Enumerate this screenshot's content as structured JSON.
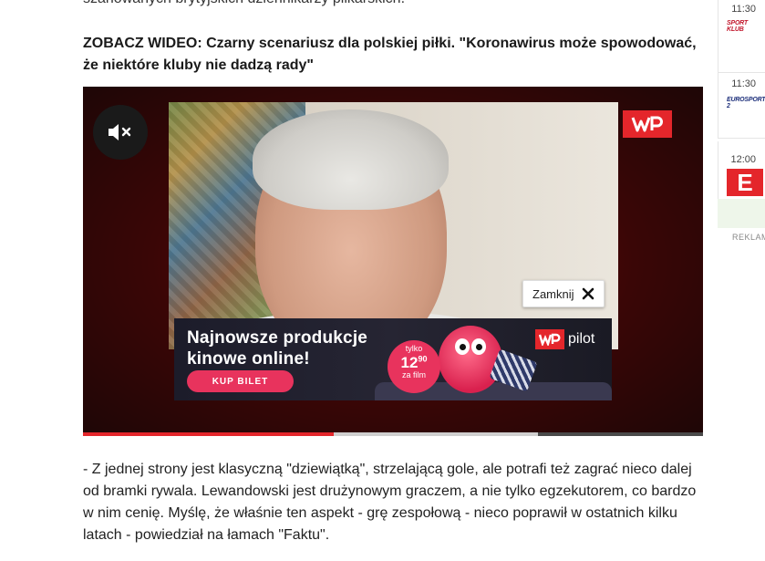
{
  "article": {
    "top_cut_text": "szanowanych brytyjskich dziennikarzy piłkarskich.",
    "headline": "ZOBACZ WIDEO: Czarny scenariusz dla polskiej piłki. \"Koronawirus może spowodować, że niektóre kluby nie dadzą rady\"",
    "paragraph": "- Z jednej strony jest klasyczną \"dziewiątką\", strzelającą gole, ale potrafi też zagrać nieco dalej od bramki rywala. Lewandowski jest drużynowym graczem, a nie tylko egzekutorem, co bardzo w nim cenię. Myślę, że właśnie ten aspekt - grę zespołową - nieco poprawił w ostatnich kilku latach - powiedział na łamach \"Faktu\"."
  },
  "video": {
    "mute_icon": "mute-icon",
    "logo_text": "WP",
    "close_label": "Zamknij",
    "close_icon": "close-icon",
    "progress_played": 0.405,
    "progress_buffered": 0.735,
    "accent_color": "#e4262b"
  },
  "ad": {
    "title_line1": "Najnowsze produkcje",
    "title_line2": "kinowe online!",
    "button_label": "KUP BILET",
    "price_prefix": "tylko",
    "price_main": "12",
    "price_cents": "90",
    "price_suffix": "za film",
    "brand_mark": "WP",
    "brand": "pilot",
    "accent_color": "#e8335d"
  },
  "sidebar": {
    "items": [
      {
        "time": "11:30",
        "channel": "SPORT KLUB"
      },
      {
        "time": "11:30",
        "channel": "EUROSPORT 2"
      },
      {
        "time": "12:00",
        "channel": "E"
      }
    ],
    "ad_label": "REKLAM"
  }
}
